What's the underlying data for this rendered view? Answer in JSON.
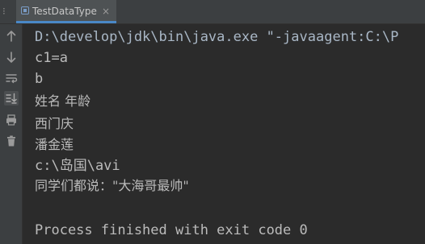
{
  "tab": {
    "title": "TestDataType",
    "close_glyph": "×",
    "icon": "java-class-icon"
  },
  "toolbar": {
    "items": [
      {
        "name": "up-arrow-icon",
        "tooltip": ""
      },
      {
        "name": "down-arrow-icon",
        "tooltip": ""
      },
      {
        "name": "soft-wrap-icon",
        "tooltip": ""
      },
      {
        "name": "scroll-to-end-icon",
        "tooltip": ""
      },
      {
        "name": "print-icon",
        "tooltip": ""
      },
      {
        "name": "trash-icon",
        "tooltip": ""
      }
    ]
  },
  "console": {
    "lines": [
      "D:\\develop\\jdk\\bin\\java.exe \"-javaagent:C:\\P",
      "c1=a",
      "b",
      "姓名 年龄",
      "西门庆",
      "潘金莲",
      "c:\\岛国\\avi",
      "同学们都说：\"大海哥最帅\"",
      "",
      "Process finished with exit code 0"
    ]
  },
  "colors": {
    "background": "#2b2b2b",
    "panel": "#3c3f41",
    "text": "#bbbbbb",
    "tab_accent": "#4a88c7"
  }
}
